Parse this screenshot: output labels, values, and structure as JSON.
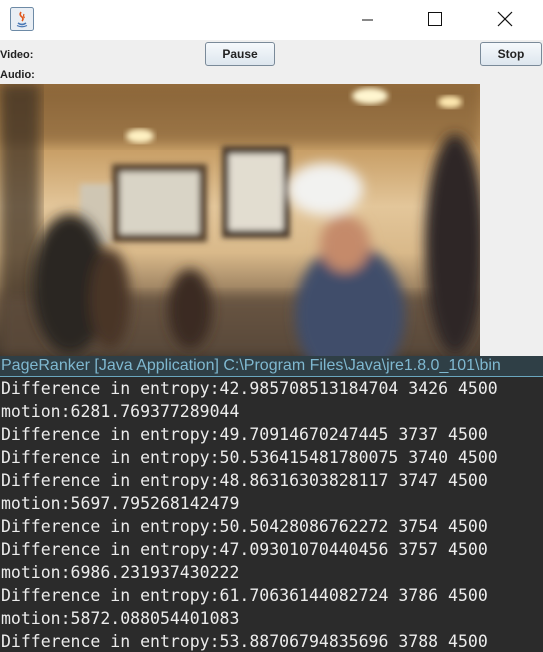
{
  "window": {
    "title": ""
  },
  "controls": {
    "video_label": "Video:",
    "audio_label": "Audio:",
    "pause_label": "Pause",
    "stop_label": "Stop"
  },
  "console": {
    "title": "PageRanker [Java Application] C:\\Program Files\\Java\\jre1.8.0_101\\bin",
    "lines": [
      "Difference in entropy:42.985708513184704 3426 4500",
      "motion:6281.769377289044",
      "Difference in entropy:49.70914670247445 3737 4500",
      "Difference in entropy:50.536415481780075 3740 4500",
      "Difference in entropy:48.86316303828117 3747 4500",
      "motion:5697.795268142479",
      "Difference in entropy:50.50428086762272 3754 4500",
      "Difference in entropy:47.09301070440456 3757 4500",
      "motion:6986.231937430222",
      "Difference in entropy:61.70636144082724 3786 4500",
      "motion:5872.088054401083",
      "Difference in entropy:53.88706794835696 3788 4500"
    ]
  },
  "colors": {
    "console_bg": "#2b2b2b",
    "console_title_bg": "#2f3f46",
    "console_title_text": "#7fb8d0",
    "console_text": "#ececec",
    "panel_bg": "#efefef"
  },
  "icons": [
    "java-app-icon",
    "minimize-icon",
    "maximize-icon",
    "close-icon"
  ]
}
